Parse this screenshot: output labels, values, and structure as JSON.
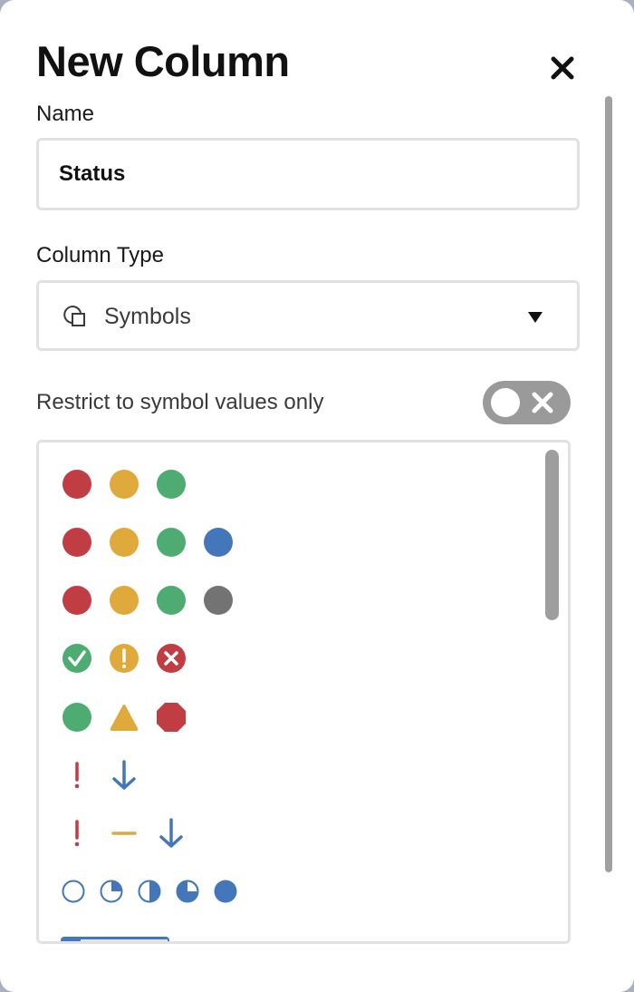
{
  "dialog": {
    "title": "New Column",
    "close_icon": "close-icon"
  },
  "name_field": {
    "label": "Name",
    "value": "Status",
    "placeholder": ""
  },
  "column_type": {
    "label": "Column Type",
    "icon": "shapes-icon",
    "selected": "Symbols",
    "caret_icon": "caret-down-icon"
  },
  "restrict": {
    "label": "Restrict to symbol values only",
    "enabled": false,
    "toggle_icon": "x-icon"
  },
  "colors": {
    "red": "#bf3d43",
    "yellow": "#e0a93b",
    "green": "#4eac72",
    "blue": "#4477b9",
    "gray": "#737373",
    "scrollbar": "#9e9e9e",
    "border": "#e1e1e1",
    "toggle_off": "#9a9a9a"
  },
  "symbol_sets": [
    {
      "name": "traffic-lights-3",
      "symbols": [
        "red-circle",
        "yellow-circle",
        "green-circle"
      ]
    },
    {
      "name": "traffic-lights-4-blue",
      "symbols": [
        "red-circle",
        "yellow-circle",
        "green-circle",
        "blue-circle"
      ]
    },
    {
      "name": "traffic-lights-4-gray",
      "symbols": [
        "red-circle",
        "yellow-circle",
        "green-circle",
        "gray-circle"
      ]
    },
    {
      "name": "status-icons",
      "symbols": [
        "green-check-circle",
        "yellow-exclamation-circle",
        "red-x-circle"
      ]
    },
    {
      "name": "shapes",
      "symbols": [
        "green-circle",
        "yellow-triangle",
        "red-octagon"
      ]
    },
    {
      "name": "priority-2",
      "symbols": [
        "red-exclamation",
        "blue-down-arrow"
      ]
    },
    {
      "name": "priority-3",
      "symbols": [
        "red-exclamation",
        "yellow-dash",
        "blue-down-arrow"
      ]
    },
    {
      "name": "progress-harvey-balls",
      "symbols": [
        "empty",
        "quarter",
        "half",
        "three-quarter",
        "full"
      ],
      "fill_values": [
        0,
        0.25,
        0.5,
        0.75,
        1
      ]
    },
    {
      "name": "progress-bar",
      "symbols": [
        "progress-bar"
      ]
    }
  ]
}
